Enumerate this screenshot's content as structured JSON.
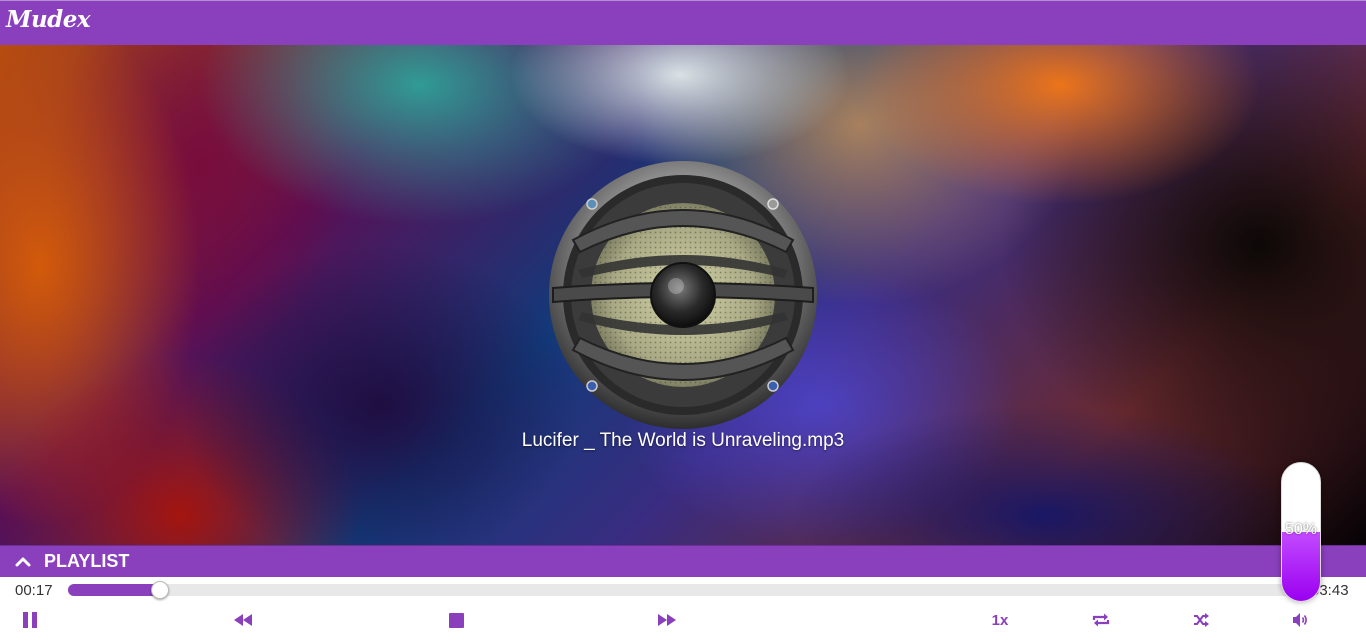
{
  "app": {
    "logo_text": "Mudex"
  },
  "now_playing": {
    "title": "Lucifer _ The World is Unraveling.mp3"
  },
  "playlist": {
    "label": "PLAYLIST",
    "toggle_icon": "chevron-up-icon"
  },
  "progress": {
    "current_time": "00:17",
    "total_time": "03:43",
    "fraction": 0.075
  },
  "controls": {
    "play_pause_icon": "pause-icon",
    "rewind_icon": "rewind-icon",
    "stop_icon": "stop-icon",
    "fast_forward_icon": "fast-forward-icon",
    "speed_label": "1x",
    "repeat_icon": "repeat-icon",
    "shuffle_icon": "shuffle-icon",
    "volume_icon": "volume-icon"
  },
  "volume": {
    "label": "50%",
    "level": 0.5
  },
  "colors": {
    "accent": "#8a3fbd",
    "volume_fill": "#b000ff"
  }
}
